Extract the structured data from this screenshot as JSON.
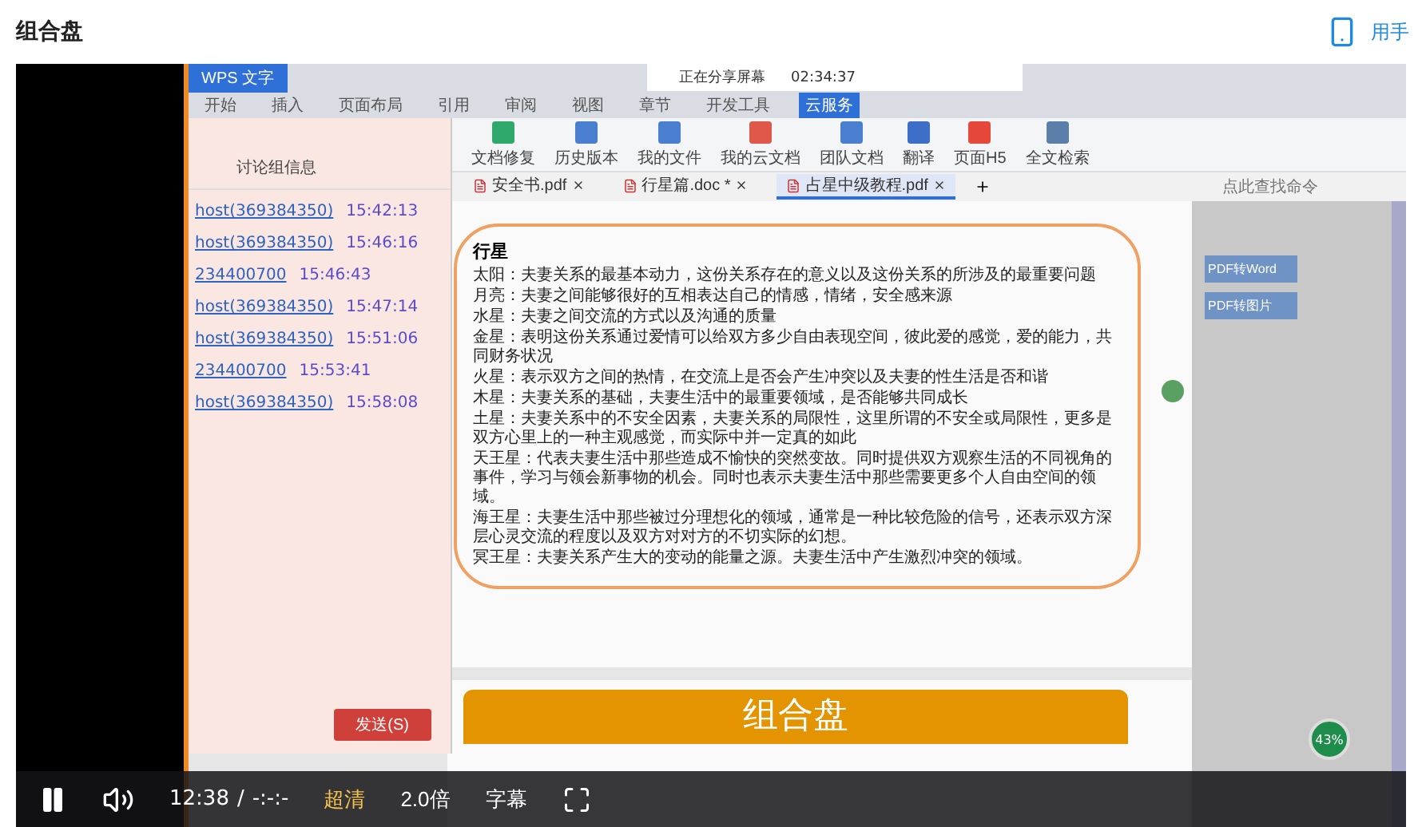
{
  "page": {
    "title": "组合盘",
    "mobile_link": "用手"
  },
  "recording": {
    "app_button": "WPS 文字",
    "ribbon_tabs": [
      {
        "label": "开始",
        "selected": false
      },
      {
        "label": "插入",
        "selected": false
      },
      {
        "label": "页面布局",
        "selected": false
      },
      {
        "label": "引用",
        "selected": false
      },
      {
        "label": "审阅",
        "selected": false
      },
      {
        "label": "视图",
        "selected": false
      },
      {
        "label": "章节",
        "selected": false
      },
      {
        "label": "开发工具",
        "selected": false
      },
      {
        "label": "云服务",
        "selected": true
      }
    ],
    "share_notice": {
      "status": "正在分享屏幕",
      "elapsed": "02:34:37"
    },
    "tools": [
      {
        "label": "文档修复",
        "color": "#2fa86b"
      },
      {
        "label": "历史版本",
        "color": "#4a7fd0"
      },
      {
        "label": "我的文件",
        "color": "#4a7fd0"
      },
      {
        "label": "我的云文档",
        "color": "#e0584a"
      },
      {
        "label": "团队文档",
        "color": "#4a7fd0"
      },
      {
        "label": "翻译",
        "color": "#3d6fc9"
      },
      {
        "label": "页面H5",
        "color": "#e5473a"
      },
      {
        "label": "全文检索",
        "color": "#5b7fa8"
      }
    ],
    "doc_tabs": [
      {
        "label": "安全书.pdf",
        "selected": false
      },
      {
        "label": "行星篇.doc *",
        "selected": false
      },
      {
        "label": "占星中级教程.pdf",
        "selected": true
      }
    ],
    "search_placeholder": "点此查找命令",
    "chat": {
      "title": "讨论组信息",
      "messages": [
        {
          "sender": "host(369384350)",
          "time": "15:42:13"
        },
        {
          "sender": "host(369384350)",
          "time": "15:46:16"
        },
        {
          "sender": "234400700",
          "time": "15:46:43"
        },
        {
          "sender": "host(369384350)",
          "time": "15:47:14"
        },
        {
          "sender": "host(369384350)",
          "time": "15:51:06"
        },
        {
          "sender": "234400700",
          "time": "15:53:41"
        },
        {
          "sender": "host(369384350)",
          "time": "15:58:08"
        }
      ],
      "send_button": "发送(S)"
    },
    "document": {
      "heading": "行星",
      "lines": [
        "太阳：夫妻关系的最基本动力，这份关系存在的意义以及这份关系的所涉及的最重要问题",
        "月亮：夫妻之间能够很好的互相表达自己的情感，情绪，安全感来源",
        "水星：夫妻之间交流的方式以及沟通的质量",
        "金星：表明这份关系通过爱情可以给双方多少自由表现空间，彼此爱的感觉，爱的能力，共同财务状况",
        "火星：表示双方之间的热情，在交流上是否会产生冲突以及夫妻的性生活是否和谐",
        "木星：夫妻关系的基础，夫妻生活中的最重要领域，是否能够共同成长",
        "土星：夫妻关系中的不安全因素，夫妻关系的局限性，这里所谓的不安全或局限性，更多是双方心里上的一种主观感觉，而实际中并一定真的如此",
        "天王星：代表夫妻生活中那些造成不愉快的突然变故。同时提供双方观察生活的不同视角的事件，学习与领会新事物的机会。同时也表示夫妻生活中那些需要更多个人自由空间的领域。",
        "海王星：夫妻生活中那些被过分理想化的领域，通常是一种比较危险的信号，还表示双方深层心灵交流的程度以及双方对对方的不切实际的幻想。",
        "冥王星：夫妻关系产生大的变动的能量之源。夫妻生活中产生激烈冲突的领域。"
      ]
    },
    "side_buttons": [
      "PDF转Word",
      "PDF转图片"
    ],
    "banner": "组合盘",
    "meter": "43%"
  },
  "player": {
    "playing": true,
    "time": "12:38",
    "separator": "/",
    "duration": "-:-:-",
    "quality": "超清",
    "speed": "2.0倍",
    "subtitles": "字幕"
  }
}
